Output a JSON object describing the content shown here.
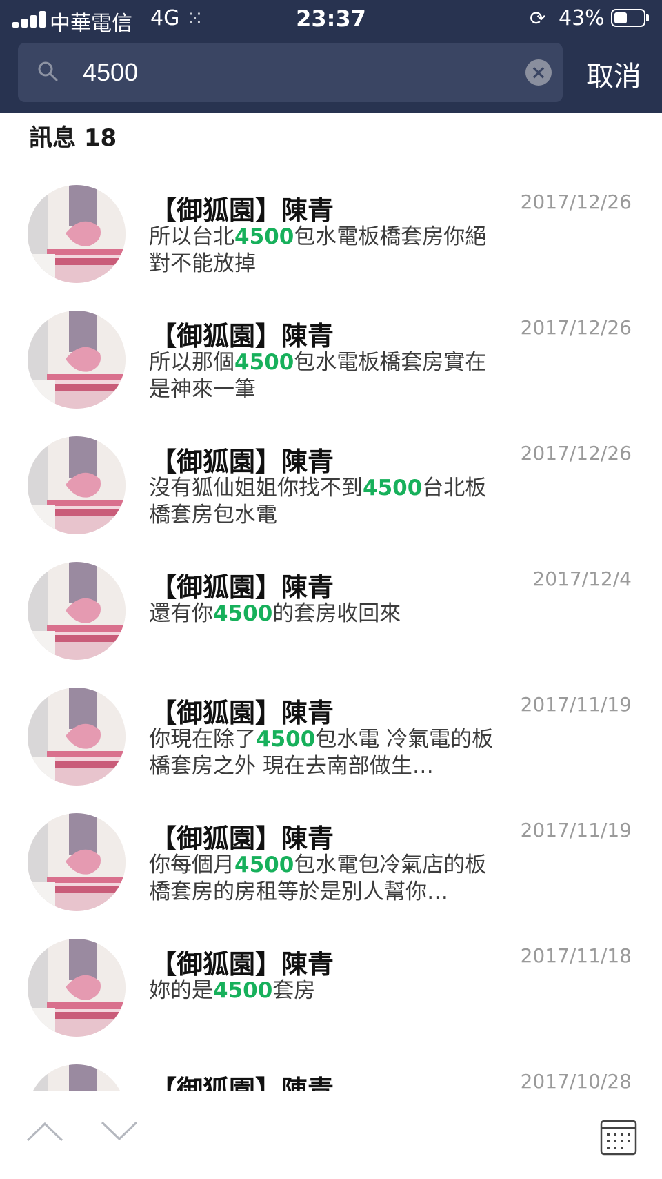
{
  "status_bar": {
    "carrier": "中華電信",
    "network": "4G",
    "time": "23:37",
    "battery": "43%",
    "battery_level": 0.43
  },
  "search": {
    "query": "4500",
    "cancel_label": "取消"
  },
  "results": {
    "section_title": "訊息 18",
    "items": [
      {
        "name": "【御狐園】陳青",
        "date": "2017/12/26",
        "pre": "所以台北",
        "match": "4500",
        "post": "包水電板橋套房你絕對不能放掉"
      },
      {
        "name": "【御狐園】陳青",
        "date": "2017/12/26",
        "pre": "所以那個",
        "match": "4500",
        "post": "包水電板橋套房實在是神來一筆"
      },
      {
        "name": "【御狐園】陳青",
        "date": "2017/12/26",
        "pre": "沒有狐仙姐姐你找不到",
        "match": "4500",
        "post": "台北板橋套房包水電"
      },
      {
        "name": "【御狐園】陳青",
        "date": "2017/12/4",
        "pre": "還有你",
        "match": "4500",
        "post": "的套房收回來"
      },
      {
        "name": "【御狐園】陳青",
        "date": "2017/11/19",
        "pre": "你現在除了",
        "match": "4500",
        "post": "包水電 冷氣電的板橋套房之外 現在去南部做生…"
      },
      {
        "name": "【御狐園】陳青",
        "date": "2017/11/19",
        "pre": "你每個月",
        "match": "4500",
        "post": "包水電包冷氣店的板橋套房的房租等於是別人幫你…"
      },
      {
        "name": "【御狐園】陳青",
        "date": "2017/11/18",
        "pre": "妳的是",
        "match": "4500",
        "post": "套房"
      },
      {
        "name": "【御狐園】陳青",
        "date": "2017/10/28",
        "pre": "",
        "match": "",
        "post": ""
      }
    ]
  },
  "colors": {
    "header_bg": "#283350",
    "search_bg": "#3a4563",
    "highlight": "#17b05b"
  },
  "icons": [
    "search-icon",
    "clear-icon",
    "chevron-up-icon",
    "chevron-down-icon",
    "calendar-icon",
    "avatar"
  ]
}
